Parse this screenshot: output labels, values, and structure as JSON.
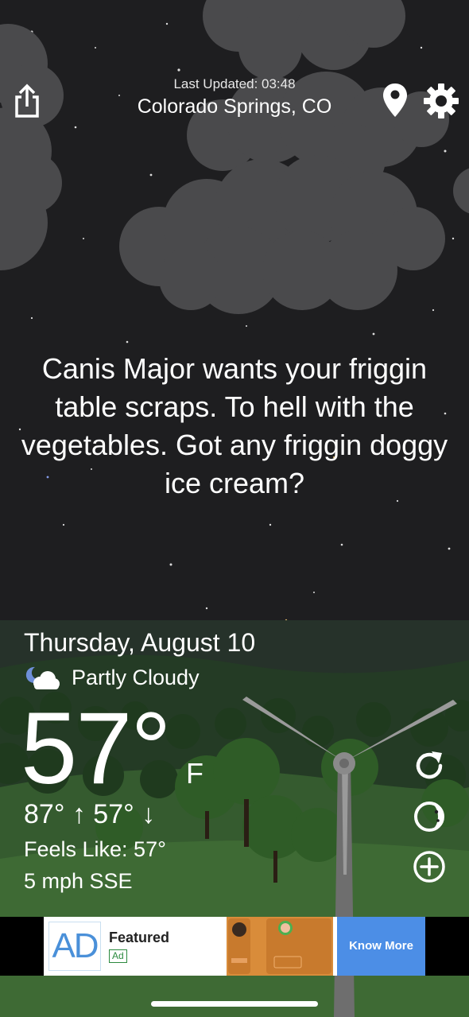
{
  "header": {
    "last_updated": "Last Updated: 03:48",
    "location": "Colorado Springs, CO"
  },
  "quote": "Canis Major wants your friggin table scraps. To hell with the vegetables. Got any friggin doggy ice cream?",
  "weather": {
    "date": "Thursday, August 10",
    "condition": "Partly Cloudy",
    "condition_icon": "partly-cloudy-night-icon",
    "temperature": "57°",
    "unit": "F",
    "hi_lo": "87° ↑  57° ↓",
    "feels_like": "Feels Like: 57°",
    "wind": "5 mph SSE"
  },
  "icons": {
    "share": "share-icon",
    "location": "location-pin-icon",
    "settings": "gear-icon",
    "refresh": "refresh-icon",
    "moon": "moon-phase-icon",
    "add": "add-circle-icon"
  },
  "ad": {
    "logo": "AD",
    "title": "Featured",
    "tag": "Ad",
    "cta": "Know More"
  },
  "colors": {
    "sky": "#1e1e20",
    "cloud": "#4a4a4c",
    "hill": "#2c4a2a",
    "ad_cta": "#4c8ee6"
  }
}
